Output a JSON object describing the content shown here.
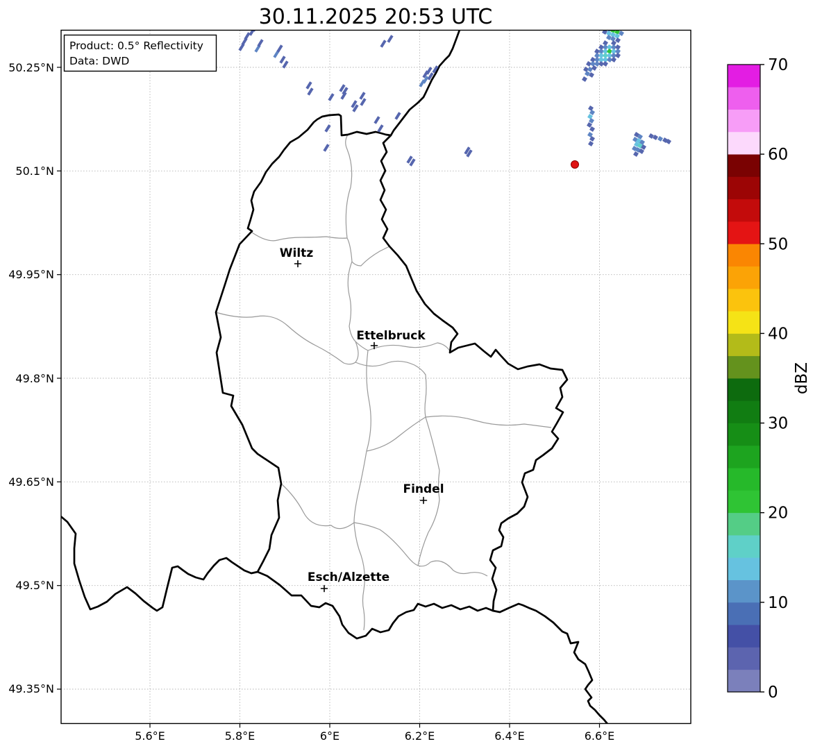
{
  "title": "30.11.2025 20:53 UTC",
  "info_box": {
    "product_line": "Product: 0.5° Reflectivity",
    "data_line": "Data: DWD"
  },
  "axes": {
    "x_tick_labels": [
      "5.6°E",
      "5.8°E",
      "6°E",
      "6.2°E",
      "6.4°E",
      "6.6°E"
    ],
    "y_tick_labels": [
      "50.25°N",
      "50.1°N",
      "49.95°N",
      "49.8°N",
      "49.65°N",
      "49.5°N",
      "49.35°N"
    ]
  },
  "cities": [
    {
      "name": "Wiltz"
    },
    {
      "name": "Ettelbruck"
    },
    {
      "name": "Findel"
    },
    {
      "name": "Esch/Alzette"
    }
  ],
  "colorbar": {
    "label": "dBZ",
    "tick_values": [
      0,
      10,
      20,
      30,
      40,
      50,
      60,
      70
    ],
    "band_colors_bottom_to_top": [
      "#7b80bb",
      "#5c64af",
      "#4450a6",
      "#4a6fb5",
      "#5b94c9",
      "#66c2e0",
      "#5fd0c8",
      "#54cd86",
      "#2fc434",
      "#26b92a",
      "#1da41f",
      "#168e16",
      "#117d12",
      "#0d6b0e",
      "#64921d",
      "#b3bb19",
      "#f5e316",
      "#fbc30d",
      "#fba306",
      "#fa8602",
      "#e41414",
      "#c30b0b",
      "#9c0505",
      "#7a0202",
      "#fcd9fc",
      "#f79df7",
      "#ee5fee",
      "#e31de3"
    ]
  },
  "radar": {
    "site_marker": {
      "color": "#e01212",
      "edge_color": "#8b0000"
    },
    "palette": {
      "L1": "#5666ae",
      "L2": "#5e85c4",
      "C": "#66c2e0",
      "T": "#5fd0c8",
      "S": "#54cd86",
      "G": "#2fc434"
    },
    "streaks": [
      [
        352,
        60
      ],
      [
        356,
        52
      ],
      [
        348,
        68
      ],
      [
        363,
        46
      ],
      [
        368,
        40
      ],
      [
        371,
        70,
        "L2"
      ],
      [
        375,
        62
      ],
      [
        398,
        78,
        "L2"
      ],
      [
        403,
        70
      ],
      [
        407,
        86
      ],
      [
        411,
        93
      ],
      [
        445,
        123
      ],
      [
        447,
        132
      ],
      [
        477,
        140
      ],
      [
        493,
        127
      ],
      [
        497,
        131
      ],
      [
        495,
        138
      ],
      [
        510,
        150
      ],
      [
        512,
        156
      ],
      [
        522,
        138
      ],
      [
        523,
        147
      ],
      [
        472,
        185
      ],
      [
        470,
        213
      ],
      [
        543,
        173
      ],
      [
        548,
        185
      ],
      [
        573,
        167
      ],
      [
        552,
        63
      ],
      [
        562,
        56
      ],
      [
        590,
        230
      ],
      [
        594,
        234
      ],
      [
        613,
        107
      ],
      [
        618,
        102
      ],
      [
        620,
        110
      ],
      [
        627,
        100
      ],
      [
        608,
        120,
        "L2"
      ],
      [
        613,
        115,
        "L2"
      ],
      [
        673,
        217
      ],
      [
        676,
        221
      ]
    ],
    "cluster_cells": [
      [
        883,
        38,
        "L2"
      ],
      [
        889,
        40,
        "L2"
      ],
      [
        877,
        42,
        "L2"
      ],
      [
        883,
        44,
        "G"
      ],
      [
        889,
        46,
        "G"
      ],
      [
        877,
        48,
        "C"
      ],
      [
        883,
        50,
        "C"
      ],
      [
        889,
        52,
        "C"
      ],
      [
        895,
        48,
        "L2"
      ],
      [
        871,
        46,
        "L1"
      ],
      [
        877,
        54,
        "L2"
      ],
      [
        883,
        56,
        "L2"
      ],
      [
        890,
        58,
        "L1"
      ],
      [
        895,
        40,
        "L1"
      ],
      [
        889,
        33,
        "L1"
      ],
      [
        876,
        35,
        "L1"
      ],
      [
        872,
        62,
        "L1"
      ],
      [
        884,
        62,
        "L1"
      ],
      [
        866,
        68,
        "L1"
      ],
      [
        872,
        68,
        "L2"
      ],
      [
        878,
        68,
        "C"
      ],
      [
        884,
        68,
        "L2"
      ],
      [
        890,
        68,
        "L1"
      ],
      [
        860,
        74,
        "L1"
      ],
      [
        866,
        74,
        "L2"
      ],
      [
        872,
        74,
        "C"
      ],
      [
        878,
        74,
        "G"
      ],
      [
        884,
        74,
        "C"
      ],
      [
        890,
        74,
        "L2"
      ],
      [
        860,
        80,
        "L2"
      ],
      [
        866,
        80,
        "C"
      ],
      [
        872,
        80,
        "T"
      ],
      [
        878,
        80,
        "C"
      ],
      [
        884,
        80,
        "L2"
      ],
      [
        890,
        80,
        "L1"
      ],
      [
        854,
        86,
        "L1"
      ],
      [
        860,
        86,
        "L2"
      ],
      [
        866,
        86,
        "C"
      ],
      [
        872,
        86,
        "C"
      ],
      [
        878,
        86,
        "L2"
      ],
      [
        884,
        86,
        "L1"
      ],
      [
        848,
        92,
        "L1"
      ],
      [
        854,
        92,
        "L2"
      ],
      [
        860,
        92,
        "L2"
      ],
      [
        866,
        92,
        "L1"
      ],
      [
        872,
        92,
        "L1"
      ],
      [
        844,
        100,
        "L1"
      ],
      [
        850,
        100,
        "L2"
      ],
      [
        856,
        98,
        "L1"
      ],
      [
        846,
        106,
        "L2"
      ],
      [
        852,
        108,
        "L1"
      ],
      [
        842,
        114,
        "L1"
      ],
      [
        851,
        156,
        "L1"
      ],
      [
        853,
        162,
        "L2"
      ],
      [
        850,
        168,
        "C"
      ],
      [
        852,
        174,
        "L2"
      ],
      [
        849,
        180,
        "L1"
      ],
      [
        853,
        186,
        "L1"
      ],
      [
        850,
        194,
        "L2"
      ],
      [
        853,
        200,
        "L1"
      ],
      [
        851,
        207,
        "L1"
      ],
      [
        917,
        194,
        "L1"
      ],
      [
        922,
        197,
        "L2"
      ],
      [
        915,
        201,
        "L2"
      ],
      [
        920,
        203,
        "C"
      ],
      [
        925,
        205,
        "L2"
      ],
      [
        917,
        208,
        "C"
      ],
      [
        922,
        210,
        "T"
      ],
      [
        927,
        212,
        "L1"
      ],
      [
        914,
        214,
        "L2"
      ],
      [
        919,
        216,
        "L2"
      ],
      [
        924,
        218,
        "L1"
      ],
      [
        916,
        222,
        "L1"
      ],
      [
        938,
        196,
        "L1"
      ],
      [
        944,
        198,
        "L1"
      ],
      [
        951,
        200,
        "L2"
      ],
      [
        958,
        202,
        "L1"
      ],
      [
        963,
        204,
        "L1"
      ]
    ]
  }
}
